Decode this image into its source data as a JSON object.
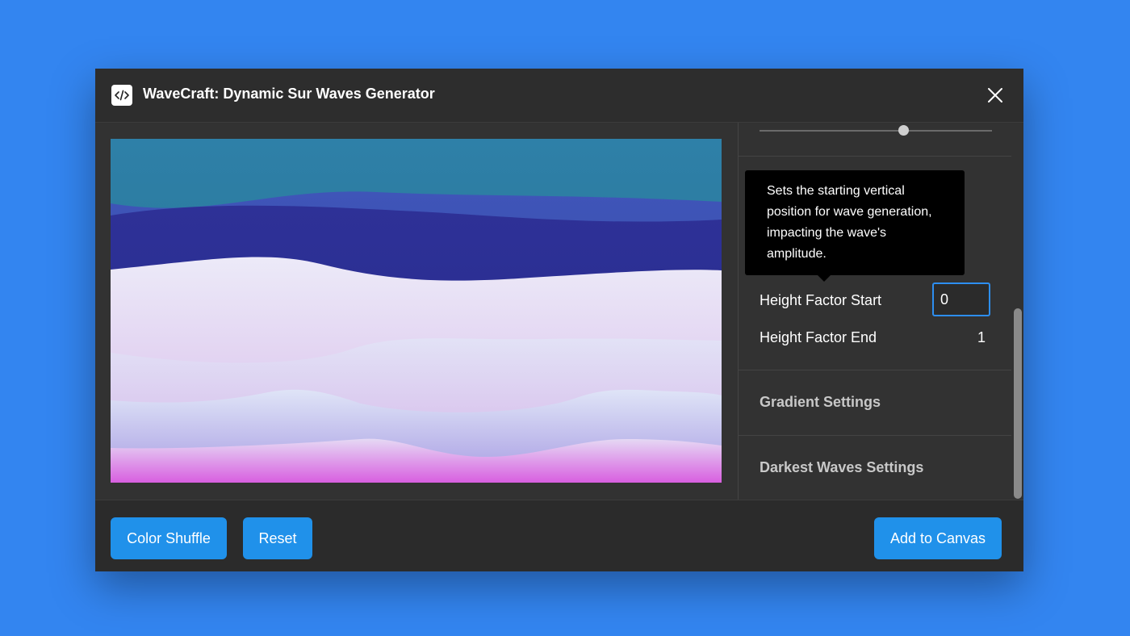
{
  "dialog": {
    "title": "WaveCraft: Dynamic Sur Waves Generator",
    "app_icon": "code-icon",
    "close_icon": "close-icon"
  },
  "panel": {
    "slider": {
      "value_fraction": 0.62
    },
    "tooltip_text": "Sets the starting vertical position for wave generation, impacting the wave's amplitude.",
    "fields": {
      "height_factor_start_label": "Height Factor Start",
      "height_factor_start_value": "0",
      "height_factor_end_label": "Height Factor End",
      "height_factor_end_value": "1"
    },
    "sections": {
      "gradient": "Gradient Settings",
      "darkest_waves": "Darkest Waves Settings"
    }
  },
  "footer": {
    "color_shuffle": "Color Shuffle",
    "reset": "Reset",
    "add_to_canvas": "Add to Canvas"
  },
  "colors": {
    "background": "#3385f0",
    "accent": "#2091ea",
    "dialog": "#2b2b2b"
  }
}
